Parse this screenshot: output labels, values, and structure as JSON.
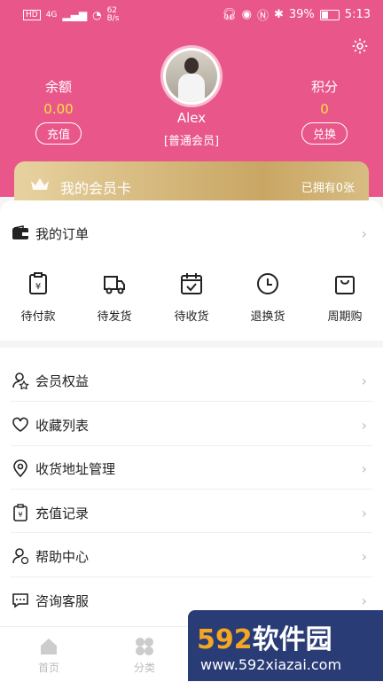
{
  "status_bar": {
    "left_tags": [
      "HD",
      "4G"
    ],
    "net_speed_value": "62",
    "net_speed_unit": "B/s",
    "battery": "39%",
    "time": "5:13"
  },
  "profile": {
    "username": "Alex",
    "level": "[普通会员]"
  },
  "balance": {
    "label": "余额",
    "value": "0.00",
    "button": "充值"
  },
  "points": {
    "label": "积分",
    "value": "0",
    "button": "兑换"
  },
  "vip_card": {
    "title": "我的会员卡",
    "owned": "已拥有0张"
  },
  "orders": {
    "title": "我的订单",
    "items": [
      {
        "label": "待付款",
        "icon": "payment-icon"
      },
      {
        "label": "待发货",
        "icon": "truck-icon"
      },
      {
        "label": "待收货",
        "icon": "calendar-check-icon"
      },
      {
        "label": "退换货",
        "icon": "clock-icon"
      },
      {
        "label": "周期购",
        "icon": "bag-icon"
      }
    ]
  },
  "menu": [
    {
      "label": "会员权益",
      "icon": "member-icon"
    },
    {
      "label": "收藏列表",
      "icon": "heart-icon"
    },
    {
      "label": "收货地址管理",
      "icon": "location-icon"
    },
    {
      "label": "充值记录",
      "icon": "receipt-icon"
    },
    {
      "label": "帮助中心",
      "icon": "help-icon"
    },
    {
      "label": "咨询客服",
      "icon": "chat-icon"
    }
  ],
  "tabbar": [
    {
      "label": "首页",
      "icon": "home-icon"
    },
    {
      "label": "分类",
      "icon": "category-icon"
    }
  ],
  "watermark": {
    "brand": "592",
    "brand_cn": "软件园",
    "url": "www.592xiazai.com"
  },
  "colors": {
    "header_pink": "#e9578a",
    "gold": "#c9a664",
    "yellow": "#ffe13b"
  }
}
